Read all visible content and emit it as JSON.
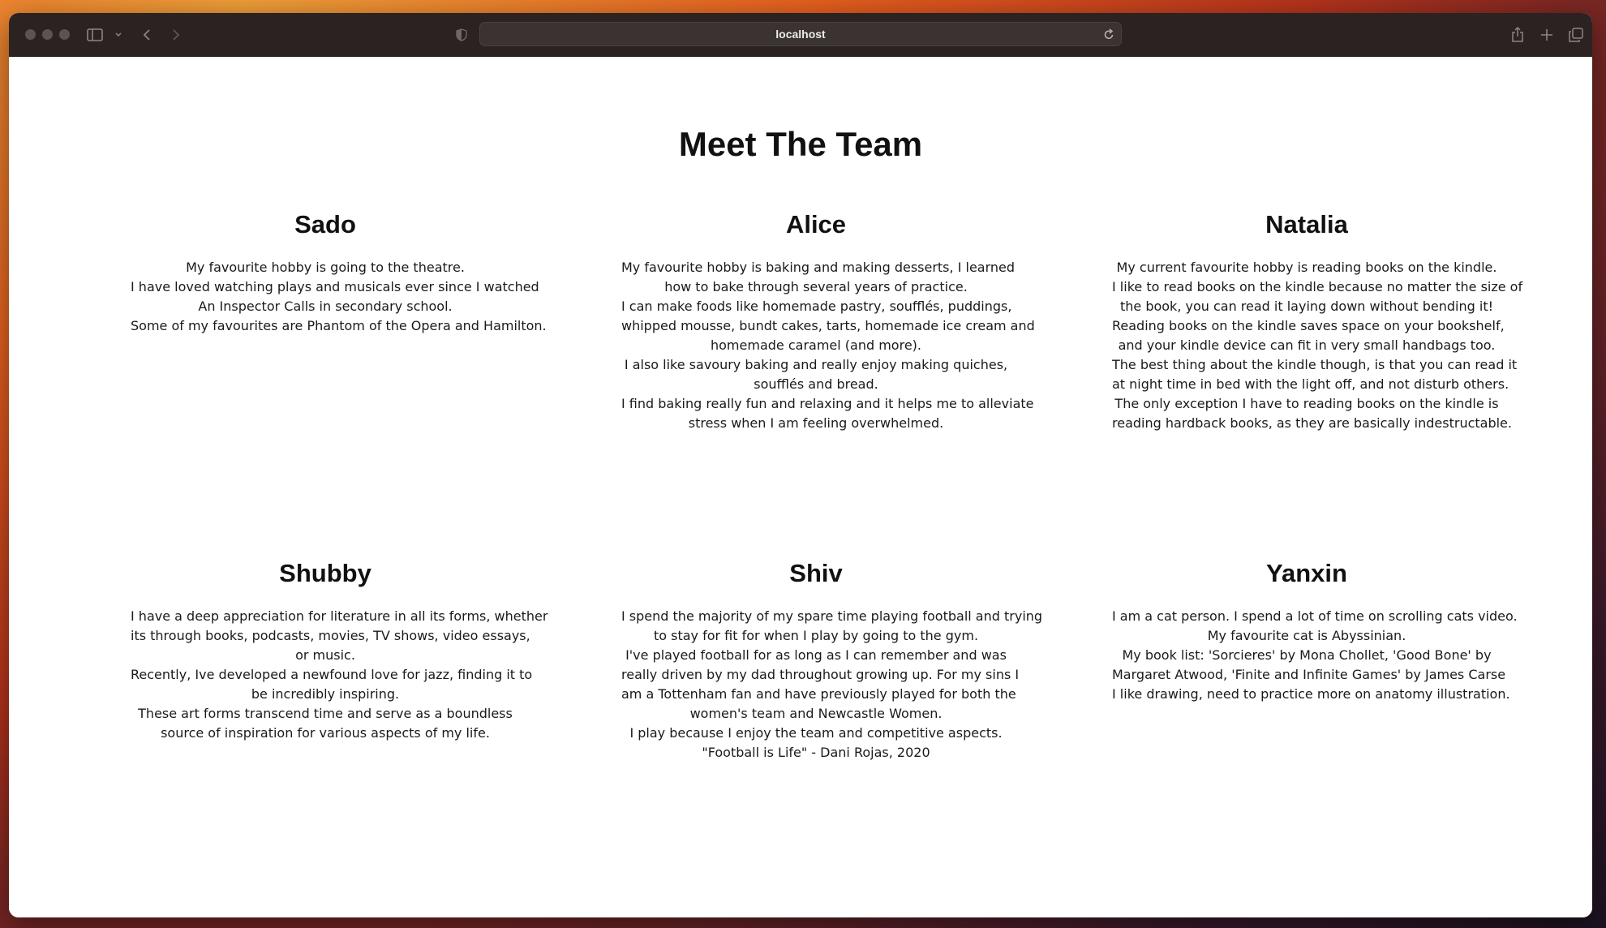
{
  "browser": {
    "url": "localhost"
  },
  "page": {
    "title": "Meet The Team"
  },
  "members": [
    {
      "name": "Sado",
      "lines": [
        "My favourite hobby is going to the theatre.",
        "I have loved watching plays and musicals ever since I watched",
        "An Inspector Calls in secondary school.",
        "Some of my favourites are Phantom of the Opera and Hamilton."
      ]
    },
    {
      "name": "Alice",
      "lines": [
        "My favourite hobby is baking and making desserts, I learned",
        "how to bake through several years of practice.",
        "I can make foods like homemade pastry, soufflés, puddings,",
        "whipped mousse, bundt cakes, tarts, homemade ice cream and",
        "homemade caramel (and more).",
        "I also like savoury baking and really enjoy making quiches,",
        "soufflés and bread.",
        "I find baking really fun and relaxing and it helps me to alleviate",
        "stress when I am feeling overwhelmed."
      ]
    },
    {
      "name": "Natalia",
      "lines": [
        "My current favourite hobby is reading books on the kindle.",
        "I like to read books on the kindle because no matter the size of",
        "the book, you can read it laying down without bending it!",
        "Reading books on the kindle saves space on your bookshelf,",
        "and your kindle device can fit in very small handbags too.",
        "The best thing about the kindle though, is that you can read it",
        "at night time in bed with the light off, and not disturb others.",
        "The only exception I have to reading books on the kindle is",
        "reading hardback books, as they are basically indestructable."
      ]
    },
    {
      "name": "Shubby",
      "lines": [
        "I have a deep appreciation for literature in all its forms, whether",
        "its through books, podcasts, movies, TV shows, video essays,",
        "or music.",
        "Recently, Ive developed a newfound love for jazz, finding it to",
        "be incredibly inspiring.",
        "These art forms transcend time and serve as a boundless",
        "source of inspiration for various aspects of my life."
      ]
    },
    {
      "name": "Shiv",
      "lines": [
        "I spend the majority of my spare time playing football and trying",
        "to stay for fit for when I play by going to the gym.",
        "I've played football for as long as I can remember and was",
        "really driven by my dad throughout growing up. For my sins I",
        "am a Tottenham fan and have previously played for both the",
        "women's team and Newcastle Women.",
        "I play because I enjoy the team and competitive aspects.",
        "\"Football is Life\" - Dani Rojas, 2020"
      ]
    },
    {
      "name": "Yanxin",
      "lines": [
        "I am a cat person. I spend a lot of time on scrolling cats video.",
        "My favourite cat is Abyssinian.",
        "My book list: 'Sorcieres' by Mona Chollet, 'Good Bone' by",
        "Margaret Atwood, 'Finite and Infinite Games' by James Carse",
        "I like drawing, need to practice more on anatomy illustration."
      ]
    }
  ]
}
